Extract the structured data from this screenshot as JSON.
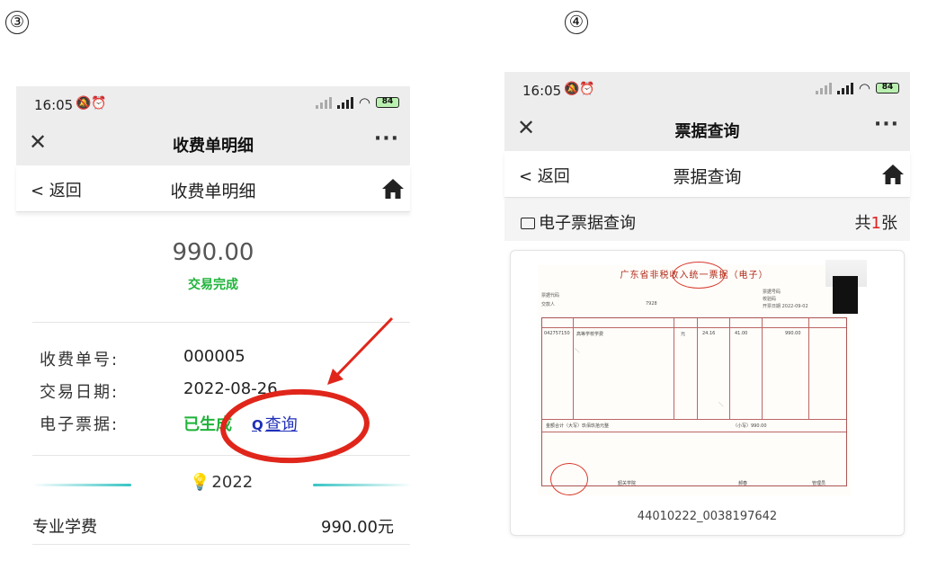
{
  "steps": {
    "left": "③",
    "right": "④"
  },
  "status": {
    "time": "16:05",
    "time_icons": "🔕⏰",
    "hd": "HD",
    "battery": "84"
  },
  "left_screen": {
    "window_title": "收费单明细",
    "more": "···",
    "close": "✕",
    "back_label": "< 返回",
    "nav_title": "收费单明细",
    "amount": "990.00",
    "trade_status": "交易完成",
    "rows": [
      {
        "label": "收费单号:",
        "value": "000005"
      },
      {
        "label": "交易日期:",
        "value": "2022-08-26"
      },
      {
        "label": "电子票据:",
        "value": "已生成"
      }
    ],
    "query_icon": "Q",
    "query_label": "查询",
    "year_icon": "💡",
    "year": "2022",
    "fee_name": "专业学费",
    "fee_amount": "990.00元"
  },
  "right_screen": {
    "window_title": "票据查询",
    "more": "···",
    "close": "✕",
    "back_label": "< 返回",
    "nav_title": "票据查询",
    "section_label": "电子票据查询",
    "count_prefix": "共",
    "count_value": "1",
    "count_suffix": "张",
    "invoice_title": "广东省非税收入统一票据（电子）",
    "invoice_meta": [
      "票据代码",
      "交款人",
      "票据号码",
      "校验码",
      "开票日期 2022-09-02"
    ],
    "invoice_code_digits": "7928",
    "invoice_row": [
      "042757150",
      "高等学校学费",
      "元",
      "24.16",
      "41.00",
      "990.00"
    ],
    "invoice_total_label": "金额合计（大写）玖佰玖拾元整",
    "invoice_total_small": "（小写）990.00",
    "invoice_payee": "韶关学院",
    "invoice_checker": "郝春",
    "invoice_issuer": "管理员",
    "invoice_caption": "44010222_0038197642"
  },
  "colors": {
    "accent_green": "#1fb33a",
    "link_blue": "#1f2fb8",
    "annotation_red": "#e0261b",
    "teal_line": "#37c4c4"
  }
}
